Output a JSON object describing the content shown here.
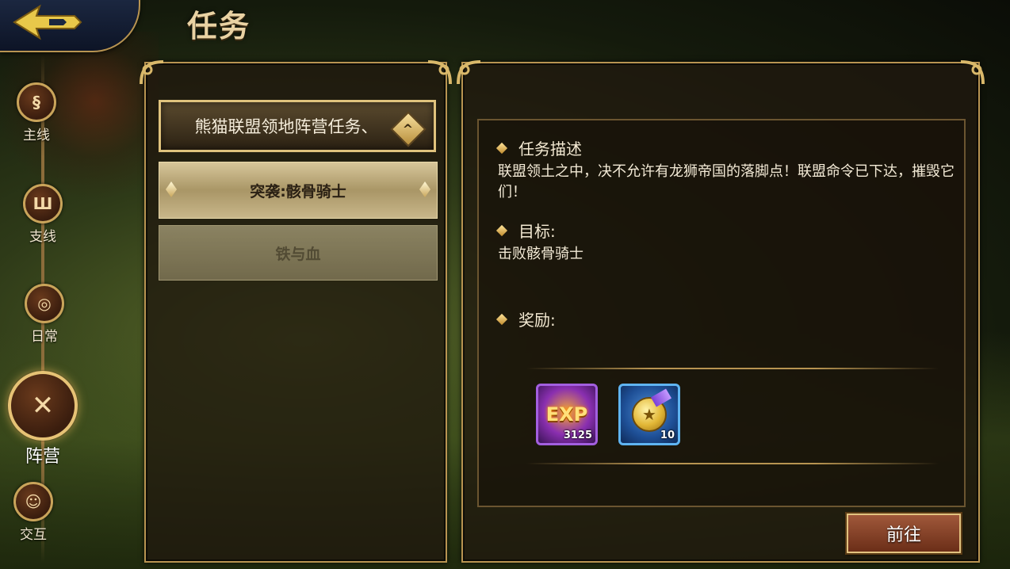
{
  "header": {
    "title": "任务"
  },
  "nav": {
    "items": [
      {
        "label": "主线",
        "icon": "scroll-icon"
      },
      {
        "label": "支线",
        "icon": "scroll-icon"
      },
      {
        "label": "日常",
        "icon": "scroll-icon"
      },
      {
        "label": "阵营",
        "icon": "crossed-swords-icon",
        "active": true
      },
      {
        "label": "交互",
        "icon": "scroll-icon"
      }
    ]
  },
  "quest_list": {
    "category": "熊猫联盟领地阵营任务、",
    "items": [
      {
        "label": "突袭:骸骨骑士",
        "selected": true
      },
      {
        "label": "铁与血",
        "selected": false
      }
    ]
  },
  "detail": {
    "description_title": "任务描述",
    "description": "联盟领土之中，决不允许有龙狮帝国的落脚点！联盟命令已下达，摧毁它们！",
    "goal_title": "目标:",
    "goal": "击败骸骨骑士",
    "reward_title": "奖励:",
    "rewards": [
      {
        "name": "EXP",
        "count": "3125",
        "icon": "exp-icon"
      },
      {
        "name": "medal",
        "count": "10",
        "icon": "medal-icon"
      }
    ],
    "go_label": "前往"
  },
  "colors": {
    "gold_border": "#b89451",
    "panel_bg": "#20180e",
    "button": "#6b2e18"
  }
}
